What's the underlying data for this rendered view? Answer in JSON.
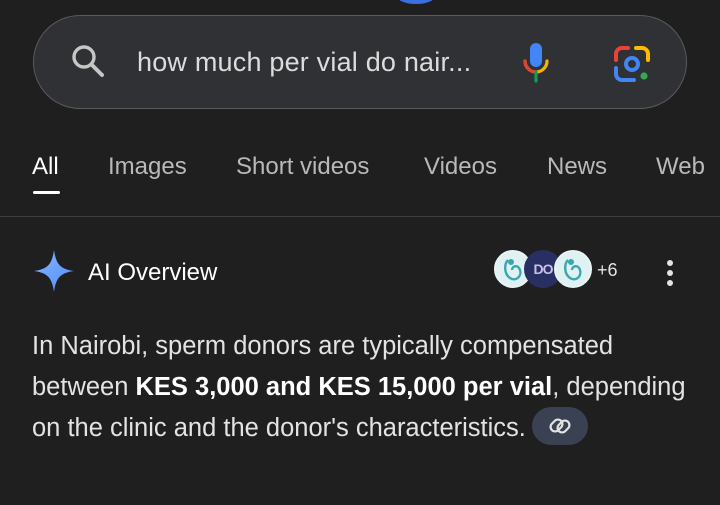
{
  "search": {
    "query": "how much per vial do nair..."
  },
  "tabs": [
    {
      "label": "All",
      "active": true
    },
    {
      "label": "Images",
      "active": false
    },
    {
      "label": "Short videos",
      "active": false
    },
    {
      "label": "Videos",
      "active": false
    },
    {
      "label": "News",
      "active": false
    },
    {
      "label": "Web",
      "active": false
    }
  ],
  "ai_overview": {
    "title": "AI Overview",
    "source_badge": "DO",
    "sources_more": "+6",
    "text_before_bold": "In Nairobi, sperm donors are typically compensated between ",
    "text_bold": "KES 3,000 and KES 15,000 per vial",
    "text_after_bold": ", depending on the clinic and the donor's characteristics."
  },
  "colors": {
    "background": "#1f1f1f",
    "searchbar": "#303134",
    "text": "#e3e3e3",
    "sparkle": "#4d8ef7",
    "link_chip": "#394152"
  }
}
